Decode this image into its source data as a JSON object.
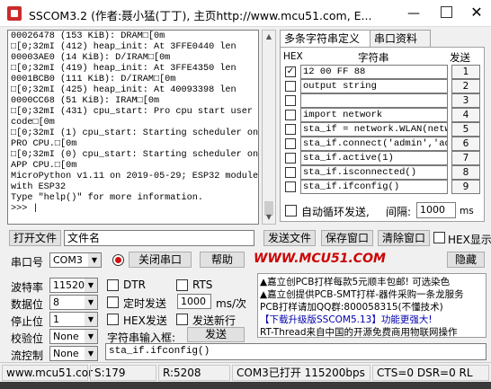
{
  "window": {
    "title": "SSCOM3.2 (作者:聂小猛(丁丁), 主页http://www.mcu51.com,  E...",
    "minimize": "—",
    "close": "✕"
  },
  "console_lines": [
    "00026478 (153 KiB): DRAM□[0m",
    "□[0;32mI (412) heap_init: At 3FFE0440 len",
    "00003AE0 (14 KiB): D/IRAM□[0m",
    "□[0;32mI (419) heap_init: At 3FFE4350 len",
    "0001BCB0 (111 KiB): D/IRAM□[0m",
    "□[0;32mI (425) heap_init: At 40093398 len",
    "0000CC68 (51 KiB): IRAM□[0m",
    "□[0;32mI (431) cpu_start: Pro cpu start user",
    "code□[0m",
    "□[0;32mI (1) cpu_start: Starting scheduler on",
    "PRO CPU.□[0m",
    "□[0;32mI (0) cpu_start: Starting scheduler on",
    "APP CPU.□[0m",
    "MicroPython v1.11 on 2019-05-29; ESP32 module",
    "with ESP32",
    "Type \"help()\" for more information.",
    ">>> |"
  ],
  "tabs": [
    "多条字符串定义",
    "串口资料"
  ],
  "multi": {
    "hex_header": "HEX",
    "str_header": "字符串",
    "send_header": "发送",
    "rows": [
      {
        "checked": true,
        "text": "12 00 FF 88",
        "num": "1"
      },
      {
        "checked": false,
        "text": "output string",
        "num": "2"
      },
      {
        "checked": false,
        "text": "",
        "num": "3"
      },
      {
        "checked": false,
        "text": "import network",
        "num": "4"
      },
      {
        "checked": false,
        "text": "sta_if = network.WLAN(netwo",
        "num": "5"
      },
      {
        "checked": false,
        "text": "sta_if.connect('admin','adm",
        "num": "6"
      },
      {
        "checked": false,
        "text": "sta_if.active(1)",
        "num": "7"
      },
      {
        "checked": false,
        "text": "sta_if.isconnected()",
        "num": "8"
      },
      {
        "checked": false,
        "text": "sta_if.ifconfig()",
        "num": "9"
      }
    ],
    "autoloop_label": "自动循环发送,",
    "interval_label": "间隔:",
    "interval_value": "1000",
    "interval_unit": "ms"
  },
  "filebar": {
    "open_file": "打开文件",
    "filename": "文件名",
    "send_file": "发送文件",
    "save_window": "保存窗口",
    "clear_window": "清除窗口",
    "hex_display": "HEX显示"
  },
  "portbar": {
    "port_label": "串口号",
    "port_value": "COM3",
    "close_port": "关闭串口",
    "help": "帮助",
    "brand": "WWW.MCU51.COM",
    "hide": "隐藏"
  },
  "settings": {
    "baud_label": "波特率",
    "baud_value": "115200",
    "databits_label": "数据位",
    "databits_value": "8",
    "stopbits_label": "停止位",
    "stopbits_value": "1",
    "parity_label": "校验位",
    "parity_value": "None",
    "flow_label": "流控制",
    "flow_value": "None"
  },
  "options": {
    "dtr": "DTR",
    "rts": "RTS",
    "timed_send": "定时发送",
    "interval_value": "1000",
    "interval_unit": "ms/次",
    "hex_send": "HEX发送",
    "send_newline": "发送新行"
  },
  "ads": [
    "▲嘉立创PCB打样每款5元顺丰包邮! 可选染色",
    "▲嘉立创提供PCB-SMT打样-器件采购一条龙服务",
    "PCB打样请加QQ群:800058315(不懂技术)",
    "【下载升级版SSCOM5.13】功能更强大!",
    "RT-Thread来自中国的开源免费商用物联网操作"
  ],
  "input": {
    "label": "字符串输入框:",
    "send": "发送",
    "value": "sta_if.ifconfig()"
  },
  "statusbar": {
    "site": "www.mcu51.cor",
    "sent": "S:179",
    "received": "R:5208",
    "port_status": "COM3已打开  115200bps",
    "signals": "CTS=0 DSR=0 RL"
  },
  "colors": {
    "brand_red": "#cc0000",
    "ad_blue": "#0000aa"
  }
}
